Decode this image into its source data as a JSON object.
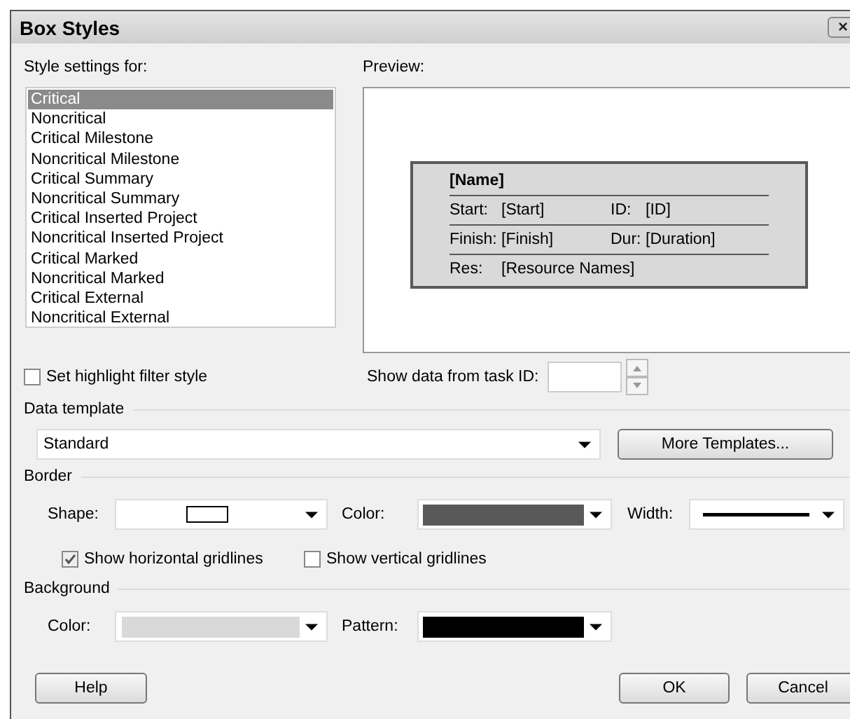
{
  "window": {
    "title": "Box Styles",
    "close": "×"
  },
  "style_settings": {
    "label": "Style settings for:",
    "items": [
      {
        "label": "Critical",
        "selected": true
      },
      {
        "label": "Noncritical",
        "selected": false
      },
      {
        "label": "Critical Milestone",
        "selected": false
      },
      {
        "label": "Noncritical Milestone",
        "selected": false
      },
      {
        "label": "Critical Summary",
        "selected": false
      },
      {
        "label": "Noncritical Summary",
        "selected": false
      },
      {
        "label": "Critical Inserted Project",
        "selected": false
      },
      {
        "label": "Noncritical Inserted Project",
        "selected": false
      },
      {
        "label": "Critical Marked",
        "selected": false
      },
      {
        "label": "Noncritical Marked",
        "selected": false
      },
      {
        "label": "Critical External",
        "selected": false
      },
      {
        "label": "Noncritical External",
        "selected": false
      }
    ]
  },
  "preview": {
    "label": "Preview:",
    "name": "[Name]",
    "rows": [
      {
        "cells": [
          "Start:",
          "[Start]",
          "ID:",
          "[ID]"
        ]
      },
      {
        "cells": [
          "Finish:",
          "[Finish]",
          "Dur:",
          "[Duration]"
        ]
      },
      {
        "cells": [
          "Res:",
          "[Resource Names]"
        ]
      }
    ]
  },
  "highlight_filter": {
    "label": "Set highlight filter style",
    "checked": false
  },
  "task_id": {
    "label": "Show data from task ID:"
  },
  "data_template": {
    "heading": "Data template",
    "value": "Standard",
    "button": "More Templates..."
  },
  "border": {
    "heading": "Border",
    "shape_label": "Shape:",
    "color_label": "Color:",
    "color": "#595959",
    "width_label": "Width:",
    "horizontal_gridlines": {
      "label": "Show horizontal gridlines",
      "checked": true
    },
    "vertical_gridlines": {
      "label": "Show vertical gridlines",
      "checked": false
    }
  },
  "background": {
    "heading": "Background",
    "color_label": "Color:",
    "color": "#d9d9d9",
    "pattern": {
      "label": "Pattern:",
      "color": "#000000"
    }
  },
  "buttons": {
    "help": "Help",
    "ok": "OK",
    "cancel": "Cancel"
  }
}
